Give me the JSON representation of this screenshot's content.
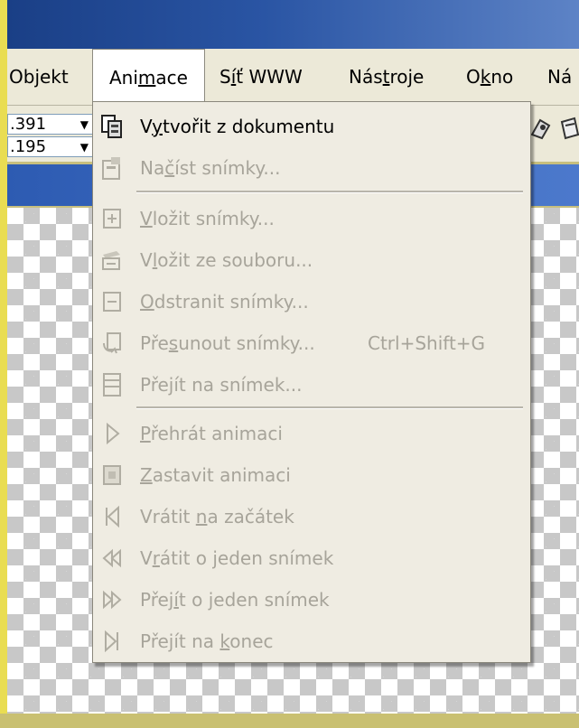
{
  "menubar": {
    "items": [
      {
        "label_parts": [
          "Objekt"
        ],
        "active": false
      },
      {
        "label_parts": [
          "Ani",
          "m",
          "ace"
        ],
        "underline_index": 1,
        "active": true
      },
      {
        "label_parts": [
          "S",
          "í",
          "ť WWW"
        ],
        "underline_index": 1,
        "active": false
      },
      {
        "label_parts": [
          "Nás",
          "t",
          "roje"
        ],
        "underline_index": 1,
        "active": false
      },
      {
        "label_parts": [
          "O",
          "k",
          "no"
        ],
        "underline_index": 1,
        "active": false
      },
      {
        "label_parts": [
          "Ná"
        ],
        "active": false
      }
    ]
  },
  "toolbar": {
    "coord_x": ".391",
    "coord_y": ".195",
    "arrow": "▼"
  },
  "dropdown": {
    "items": [
      {
        "icon": "create-from-document-icon",
        "pre": "V",
        "ul": "y",
        "post": "tvořit z dokumentu",
        "shortcut": "",
        "enabled": true
      },
      {
        "icon": "load-frames-icon",
        "pre": "Na",
        "ul": "č",
        "post": "íst snímky...",
        "shortcut": "",
        "enabled": false
      },
      {
        "sep": true
      },
      {
        "icon": "insert-frames-icon",
        "pre": "",
        "ul": "V",
        "post": "ložit snímky...",
        "shortcut": "",
        "enabled": false
      },
      {
        "icon": "insert-from-file-icon",
        "pre": "V",
        "ul": "l",
        "post": "ožit ze souboru...",
        "shortcut": "",
        "enabled": false
      },
      {
        "icon": "delete-frames-icon",
        "pre": "",
        "ul": "O",
        "post": "dstranit snímky...",
        "shortcut": "",
        "enabled": false
      },
      {
        "icon": "move-frames-icon",
        "pre": "Pře",
        "ul": "s",
        "post": "unout snímky...",
        "shortcut": "Ctrl+Shift+G",
        "enabled": false
      },
      {
        "icon": "go-to-frame-icon",
        "pre": "Pře",
        "ul": "j",
        "post": "ít na snímek...",
        "shortcut": "",
        "enabled": false
      },
      {
        "sep": true
      },
      {
        "icon": "play-icon",
        "pre": "",
        "ul": "P",
        "post": "řehrát animaci",
        "shortcut": "",
        "enabled": false
      },
      {
        "icon": "stop-icon",
        "pre": "",
        "ul": "Z",
        "post": "astavit animaci",
        "shortcut": "",
        "enabled": false
      },
      {
        "icon": "rewind-start-icon",
        "pre": "Vrátit ",
        "ul": "n",
        "post": "a začátek",
        "shortcut": "",
        "enabled": false
      },
      {
        "icon": "step-back-icon",
        "pre": "V",
        "ul": "r",
        "post": "átit o jeden snímek",
        "shortcut": "",
        "enabled": false
      },
      {
        "icon": "step-forward-icon",
        "pre": "Přej",
        "ul": "í",
        "post": "t o jeden snímek",
        "shortcut": "",
        "enabled": false
      },
      {
        "icon": "go-to-end-icon",
        "pre": "Přejít na ",
        "ul": "k",
        "post": "onec",
        "shortcut": "",
        "enabled": false
      }
    ]
  }
}
